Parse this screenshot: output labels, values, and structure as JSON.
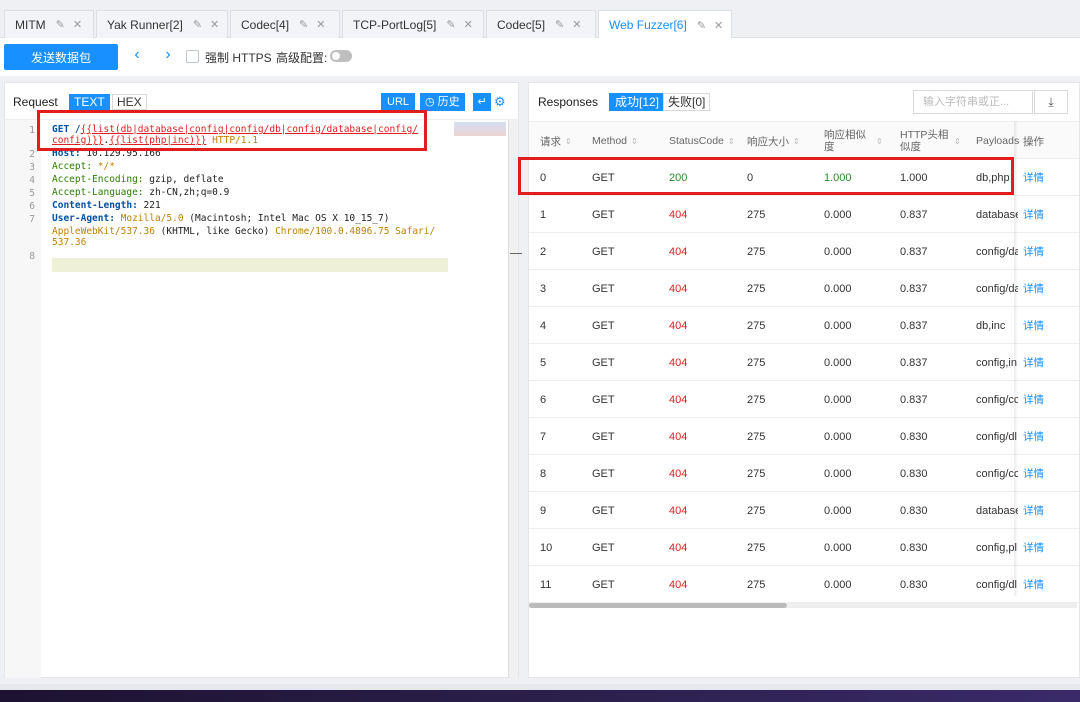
{
  "tabs": [
    {
      "label": "MITM"
    },
    {
      "label": "Yak Runner[2]"
    },
    {
      "label": "Codec[4]"
    },
    {
      "label": "TCP-PortLog[5]"
    },
    {
      "label": "Codec[5]"
    },
    {
      "label": "Web Fuzzer[6]"
    }
  ],
  "toolbar": {
    "send_label": "发送数据包",
    "force_https_label": "强制 HTTPS",
    "advanced_label": "高级配置:"
  },
  "request": {
    "title": "Request",
    "text_tag": "TEXT",
    "hex_tag": "HEX",
    "url_btn": "URL",
    "history_btn": "历史",
    "lines": [
      {
        "num": "1",
        "parts": [
          {
            "t": "GET /",
            "c": "kw"
          },
          {
            "t": "{{list(db|database|config|config/db|config/database|config/",
            "c": "red"
          }
        ]
      },
      {
        "num": "",
        "parts": [
          {
            "t": "config)}}",
            "c": "red"
          },
          {
            "t": ".",
            "c": ""
          },
          {
            "t": "{{list(php|inc)}}",
            "c": "red"
          },
          {
            "t": " HTTP/1.1",
            "c": "org"
          }
        ]
      },
      {
        "num": "2",
        "parts": [
          {
            "t": "Host: ",
            "c": "kw"
          },
          {
            "t": "10.129.95.166",
            "c": ""
          }
        ]
      },
      {
        "num": "3",
        "parts": [
          {
            "t": "Accept: ",
            "c": "grn"
          },
          {
            "t": "*/*",
            "c": "org"
          }
        ]
      },
      {
        "num": "4",
        "parts": [
          {
            "t": "Accept-Encoding: ",
            "c": "grn"
          },
          {
            "t": "gzip, deflate",
            "c": ""
          }
        ]
      },
      {
        "num": "5",
        "parts": [
          {
            "t": "Accept-Language: ",
            "c": "grn"
          },
          {
            "t": "zh-CN,zh;q=0.9",
            "c": ""
          }
        ]
      },
      {
        "num": "6",
        "parts": [
          {
            "t": "Content-Length: ",
            "c": "kw"
          },
          {
            "t": "221",
            "c": ""
          }
        ]
      },
      {
        "num": "7",
        "parts": [
          {
            "t": "User-Agent: ",
            "c": "kw"
          },
          {
            "t": "Mozilla/5.0",
            "c": "org"
          },
          {
            "t": " (Macintosh; Intel Mac OS X 10_15_7)",
            "c": ""
          }
        ]
      },
      {
        "num": "",
        "parts": [
          {
            "t": "AppleWebKit/537.36",
            "c": "org"
          },
          {
            "t": " (KHTML, like Gecko) ",
            "c": ""
          },
          {
            "t": "Chrome/100.0.4896.75 Safari/",
            "c": "org"
          }
        ]
      },
      {
        "num": "",
        "parts": [
          {
            "t": "537.36",
            "c": "org"
          }
        ]
      },
      {
        "num": "8",
        "parts": []
      }
    ]
  },
  "response": {
    "title": "Responses",
    "success_tag": "成功[12]",
    "fail_tag": "失败[0]",
    "search_placeholder": "输入字符串或正...",
    "columns": [
      "请求",
      "Method",
      "StatusCode",
      "响应大小",
      "响应相似度",
      "HTTP头相似度",
      "Payloads",
      "操作"
    ],
    "rows": [
      [
        "0",
        "GET",
        "200",
        "0",
        "1.000",
        "1.000",
        "db,php",
        "详情"
      ],
      [
        "1",
        "GET",
        "404",
        "275",
        "0.000",
        "0.837",
        "database",
        "详情"
      ],
      [
        "2",
        "GET",
        "404",
        "275",
        "0.000",
        "0.837",
        "config/da",
        "详情"
      ],
      [
        "3",
        "GET",
        "404",
        "275",
        "0.000",
        "0.837",
        "config/da",
        "详情"
      ],
      [
        "4",
        "GET",
        "404",
        "275",
        "0.000",
        "0.837",
        "db,inc",
        "详情"
      ],
      [
        "5",
        "GET",
        "404",
        "275",
        "0.000",
        "0.837",
        "config,in",
        "详情"
      ],
      [
        "6",
        "GET",
        "404",
        "275",
        "0.000",
        "0.837",
        "config/cc",
        "详情"
      ],
      [
        "7",
        "GET",
        "404",
        "275",
        "0.000",
        "0.830",
        "config/dl",
        "详情"
      ],
      [
        "8",
        "GET",
        "404",
        "275",
        "0.000",
        "0.830",
        "config/cc",
        "详情"
      ],
      [
        "9",
        "GET",
        "404",
        "275",
        "0.000",
        "0.830",
        "database",
        "详情"
      ],
      [
        "10",
        "GET",
        "404",
        "275",
        "0.000",
        "0.830",
        "config,pl",
        "详情"
      ],
      [
        "11",
        "GET",
        "404",
        "275",
        "0.000",
        "0.830",
        "config/dl",
        "详情"
      ]
    ]
  },
  "colors": {
    "accent": "#1890ff",
    "highlight_box": "#e11d1d",
    "error": "#e02020",
    "ok": "#2a8c2a"
  }
}
